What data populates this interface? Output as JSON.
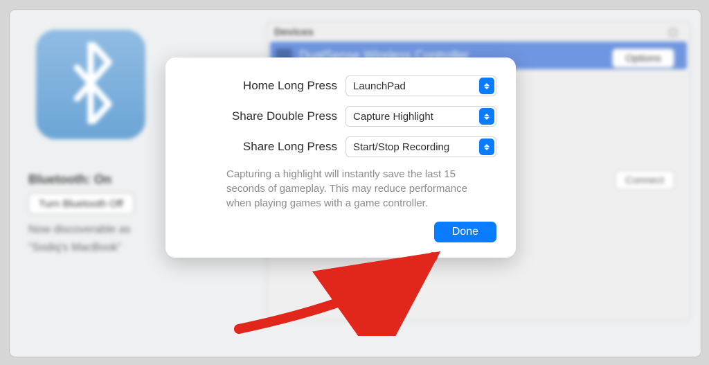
{
  "sidebar": {
    "status": "Bluetooth: On",
    "toggle_label": "Turn Bluetooth Off",
    "discover_line1": "Now discoverable as",
    "discover_line2": "“Sodiq’s MacBook”"
  },
  "devices": {
    "header": "Devices",
    "row_name": "DualSense Wireless Controller",
    "options_label": "Options",
    "connect_label": "Connect"
  },
  "modal": {
    "rows": [
      {
        "label": "Home Long Press",
        "value": "LaunchPad"
      },
      {
        "label": "Share Double Press",
        "value": "Capture Highlight"
      },
      {
        "label": "Share Long Press",
        "value": "Start/Stop Recording"
      }
    ],
    "note": "Capturing a highlight will instantly save the last 15 seconds of gameplay. This may reduce performance when playing games with a game controller.",
    "done_label": "Done"
  }
}
